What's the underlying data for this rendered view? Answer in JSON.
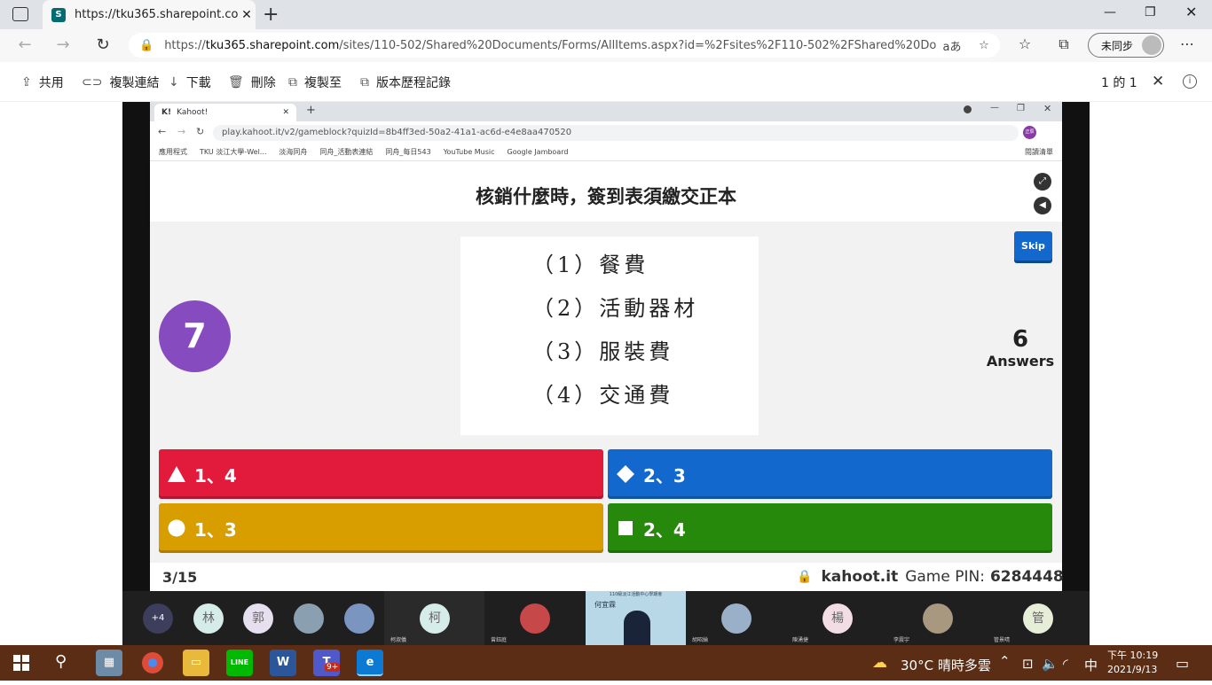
{
  "browser": {
    "tab_title": "https://tku365.sharepoint.com/si",
    "url_prefix": "https://",
    "url_host": "tku365.sharepoint.com",
    "url_rest": "/sites/110-502/Shared%20Documents/Forms/AllItems.aspx?id=%2Fsites%2F110-502%2FShared%20Docum...",
    "profile_label": "未同步",
    "read_aloud_label": "aあ"
  },
  "sharepoint": {
    "commands": [
      "共用",
      "複製連結",
      "下載",
      "刪除",
      "複製至",
      "版本歷程記錄"
    ],
    "page_count": "1 的 1"
  },
  "inner_browser": {
    "tab_title": "Kahoot!",
    "url": "play.kahoot.it/v2/gameblock?quizId=8b4ff3ed-50a2-41a1-ac6d-e4e8aa470520",
    "bookmarks": [
      "應用程式",
      "TKU 淡江大學-Wel...",
      "淡海同舟",
      "同舟_活動表連結",
      "同舟_每日543",
      "YouTube Music",
      "Google Jamboard"
    ],
    "reading_list": "閱讀清單",
    "profile_initials": "正辰"
  },
  "kahoot": {
    "question": "核銷什麼時，簽到表須繳交正本",
    "image_lines": [
      "（1）餐費",
      "（2）活動器材",
      "（3）服裝費",
      "（4）交通費"
    ],
    "timer": "7",
    "skip_label": "Skip",
    "answers_count": "6",
    "answers_label": "Answers",
    "answers": [
      {
        "shape": "triangle",
        "label": "1、4",
        "color": "#e21b3c"
      },
      {
        "shape": "diamond",
        "label": "2、3",
        "color": "#1368ce"
      },
      {
        "shape": "circle",
        "label": "1、3",
        "color": "#d89e00"
      },
      {
        "shape": "square",
        "label": "2、4",
        "color": "#26890c"
      }
    ],
    "progress": "3/15",
    "site": "kahoot.it",
    "pin_label": "Game PIN:",
    "pin": "6284448"
  },
  "participants": {
    "more": "+4",
    "avatars": [
      "林",
      "郭",
      "柯",
      "楊",
      "管"
    ],
    "names": [
      "柯淑儀",
      "曾鈺庭",
      "胡昭綸",
      "陳湧捷",
      "李震宇",
      "管景晴"
    ],
    "presenter_caption": "何宜霖",
    "presenter_banner": "110級淡江活動中心學期會"
  },
  "taskbar": {
    "weather": "30°C 晴時多雲",
    "ime": "中",
    "time": "下午 10:19",
    "date": "2021/9/13",
    "badge": "9+"
  }
}
